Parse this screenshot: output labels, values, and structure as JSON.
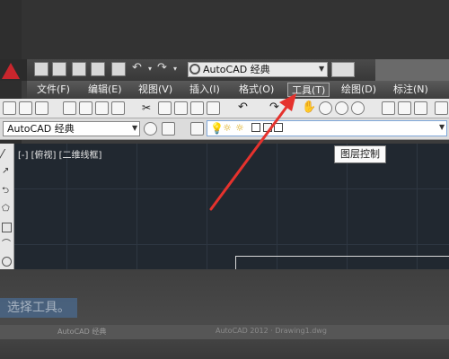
{
  "quick_access": {
    "workspace": "AutoCAD 经典"
  },
  "menubar": {
    "items": [
      "文件(F)",
      "编辑(E)",
      "视图(V)",
      "插入(I)",
      "格式(O)",
      "工具(T)",
      "绘图(D)",
      "标注(N)"
    ],
    "highlighted": "工具(T)"
  },
  "toolbar2": {
    "workspace_value": "AutoCAD 经典"
  },
  "canvas": {
    "viewport_label": "[-] [俯视] [二维线框]"
  },
  "tooltip": {
    "text": "图层控制"
  },
  "bottom": {
    "caption": "选择工具。",
    "status_left": "AutoCAD 经典",
    "status_right": "AutoCAD 2012 · Drawing1.dwg"
  },
  "colors": {
    "canvas_bg": "#212830",
    "arrow": "#e5322d",
    "menu_bar": "#4a4a4a"
  },
  "icons": [
    "new-icon",
    "open-icon",
    "save-icon",
    "saveas-icon",
    "print-icon",
    "undo-icon",
    "redo-icon",
    "pan-hand-icon",
    "zoom-icon",
    "layer-bulb-icon",
    "gear-icon"
  ]
}
